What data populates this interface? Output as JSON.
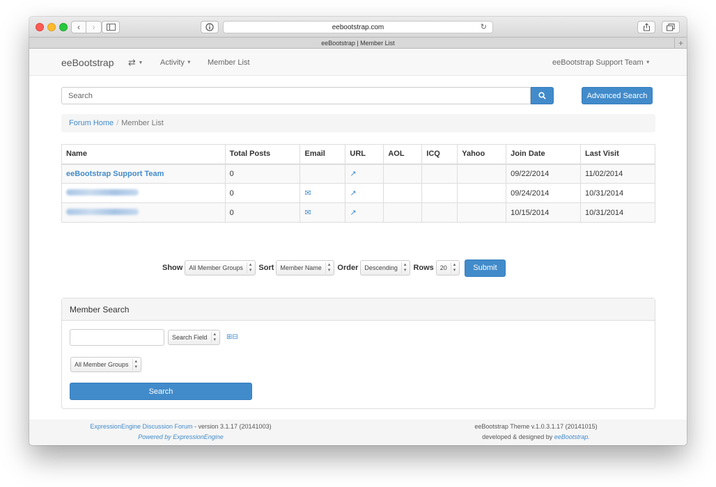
{
  "browser": {
    "url": "eebootstrap.com",
    "tab_title": "eeBootstrap | Member List"
  },
  "navbar": {
    "brand": "eeBootstrap",
    "activity": "Activity",
    "member_list": "Member List",
    "user": "eeBootstrap Support Team"
  },
  "search": {
    "placeholder": "Search",
    "advanced_label": "Advanced Search"
  },
  "breadcrumb": {
    "home": "Forum Home",
    "separator": "/",
    "current": "Member List"
  },
  "table": {
    "headers": [
      "Name",
      "Total Posts",
      "Email",
      "URL",
      "AOL",
      "ICQ",
      "Yahoo",
      "Join Date",
      "Last Visit"
    ],
    "rows": [
      {
        "name": "eeBootstrap Support Team",
        "posts": "0",
        "join": "09/22/2014",
        "last": "11/02/2014"
      },
      {
        "name": "",
        "posts": "0",
        "join": "09/24/2014",
        "last": "10/31/2014"
      },
      {
        "name": "",
        "posts": "0",
        "join": "10/15/2014",
        "last": "10/31/2014"
      }
    ]
  },
  "controls": {
    "show_label": "Show",
    "show_value": "All Member Groups",
    "sort_label": "Sort",
    "sort_value": "Member Name",
    "order_label": "Order",
    "order_value": "Descending",
    "rows_label": "Rows",
    "rows_value": "20",
    "submit": "Submit"
  },
  "member_search": {
    "title": "Member Search",
    "field_value": "Search Field",
    "groups_value": "All Member Groups",
    "button": "Search"
  },
  "footer": {
    "left_link": "ExpressionEngine Discussion Forum",
    "left_version": " - version 3.1.17 (20141003)",
    "left_powered": "Powered by ExpressionEngine",
    "right_theme": "eeBootstrap Theme v.1.0.3.1.17 (20141015)",
    "right_dev": "developed & designed by ",
    "right_link": "eeBootstrap."
  },
  "colors": {
    "primary": "#428bca",
    "close": "#fd5c55",
    "minimize": "#fdbb2d",
    "zoom": "#28c73f"
  }
}
